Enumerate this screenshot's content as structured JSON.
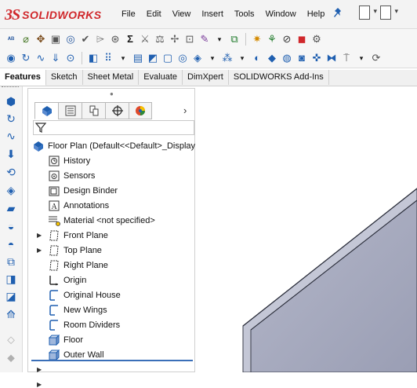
{
  "app": {
    "logo_ds": "3S",
    "logo_text": "SOLIDWORKS"
  },
  "menu": [
    "File",
    "Edit",
    "View",
    "Insert",
    "Tools",
    "Window",
    "Help"
  ],
  "command_tabs": [
    "Features",
    "Sketch",
    "Sheet Metal",
    "Evaluate",
    "DimXpert",
    "SOLIDWORKS Add-Ins"
  ],
  "tree": {
    "root": "Floor Plan  (Default<<Default>_Display S",
    "items": [
      {
        "label": "History",
        "icon": "history-icon",
        "expandable": false
      },
      {
        "label": "Sensors",
        "icon": "sensors-icon",
        "expandable": false
      },
      {
        "label": "Design Binder",
        "icon": "design-binder-icon",
        "expandable": true
      },
      {
        "label": "Annotations",
        "icon": "annotations-icon",
        "expandable": true
      },
      {
        "label": "Material <not specified>",
        "icon": "material-icon",
        "expandable": false
      },
      {
        "label": "Front Plane",
        "icon": "plane-icon",
        "expandable": false
      },
      {
        "label": "Top Plane",
        "icon": "plane-icon",
        "expandable": false
      },
      {
        "label": "Right Plane",
        "icon": "plane-icon",
        "expandable": false
      },
      {
        "label": "Origin",
        "icon": "origin-icon",
        "expandable": false
      },
      {
        "label": "Original House",
        "icon": "sketch-icon",
        "expandable": false
      },
      {
        "label": "New Wings",
        "icon": "sketch-icon",
        "expandable": false
      },
      {
        "label": "Room Dividers",
        "icon": "sketch-icon",
        "expandable": false
      },
      {
        "label": "Floor",
        "icon": "extrude-feature-icon",
        "expandable": true
      },
      {
        "label": "Outer Wall",
        "icon": "extrude-feature-icon",
        "expandable": true
      }
    ]
  },
  "colors": {
    "brand": "#d0272b",
    "part_face": "#a9adc2",
    "part_edge": "#3a3d4a",
    "selection": "#3a6fb8"
  }
}
